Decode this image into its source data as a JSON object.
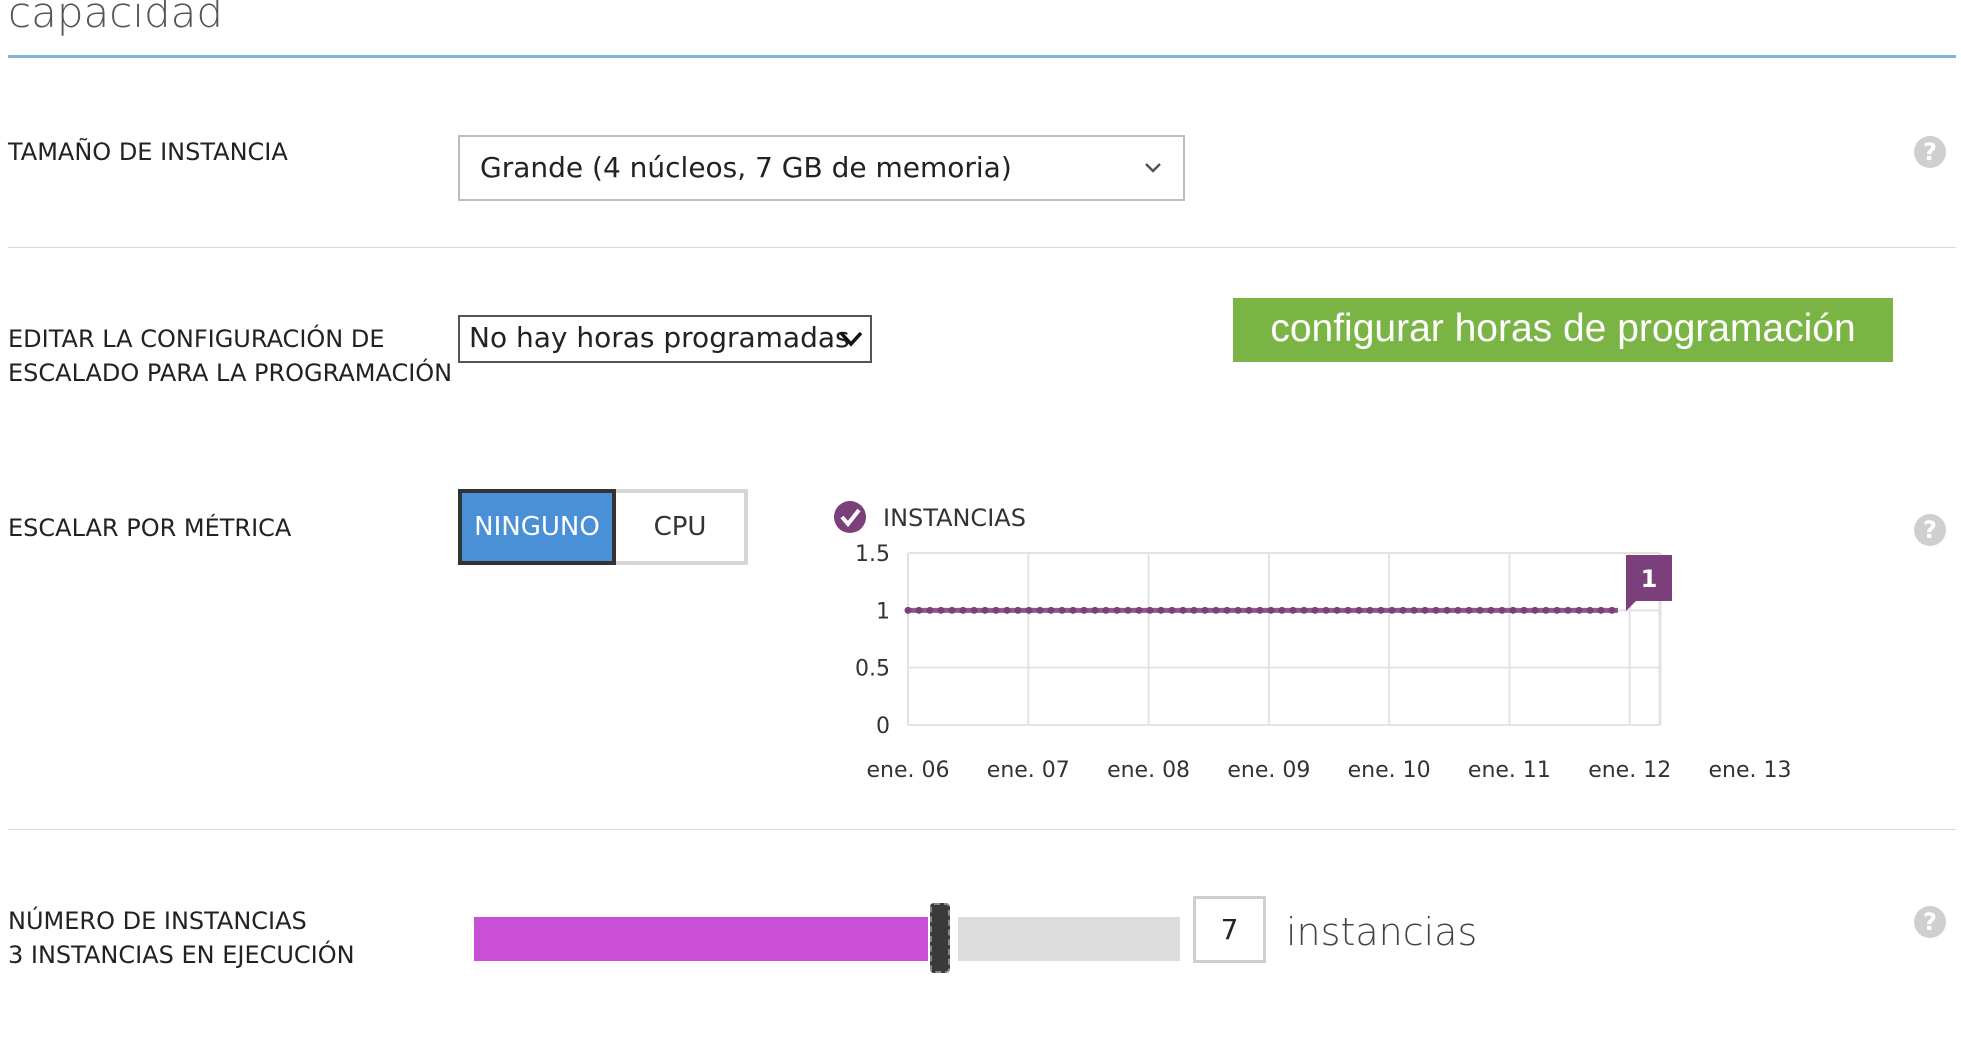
{
  "page": {
    "title": "capacidad"
  },
  "instance_size": {
    "label": "TAMAÑO DE INSTANCIA",
    "selected": "Grande (4 núcleos, 7 GB de memoria)"
  },
  "schedule": {
    "label_line1": "EDITAR LA CONFIGURACIÓN DE",
    "label_line2": "ESCALADO PARA LA PROGRAMACIÓN",
    "selected": "No hay horas programadas",
    "configure_button": "configurar horas de programación",
    "button_color": "#7ab445"
  },
  "metric": {
    "label": "ESCALAR POR MÉTRICA",
    "options": [
      "NINGUNO",
      "CPU"
    ],
    "selected": "NINGUNO",
    "selected_color": "#4a90d6"
  },
  "chart_data": {
    "type": "line",
    "x": [
      "ene. 06",
      "ene. 07",
      "ene. 08",
      "ene. 09",
      "ene. 10",
      "ene. 11",
      "ene. 12",
      "ene. 13"
    ],
    "yticks": [
      "1.5",
      "1",
      "0.5",
      "0"
    ],
    "ylim": [
      0,
      1.5
    ],
    "series": [
      {
        "name": "INSTANCIAS",
        "color": "#7b3f7b",
        "values": [
          1,
          1,
          1,
          1,
          1,
          1,
          1
        ]
      }
    ],
    "last_value_label": "1",
    "grid": true,
    "legend": "top-left"
  },
  "instances": {
    "label_line1": "NÚMERO DE INSTANCIAS",
    "label_line2": "3 INSTANCIAS EN EJECUCIÓN",
    "value": "7",
    "unit": "instancias",
    "slider_fraction": 0.63,
    "fill_color": "#c84fd6"
  },
  "icons": {
    "help": "question-circle-icon",
    "dropdown": "chevron-down-icon",
    "legend_check": "check-circle-icon"
  }
}
